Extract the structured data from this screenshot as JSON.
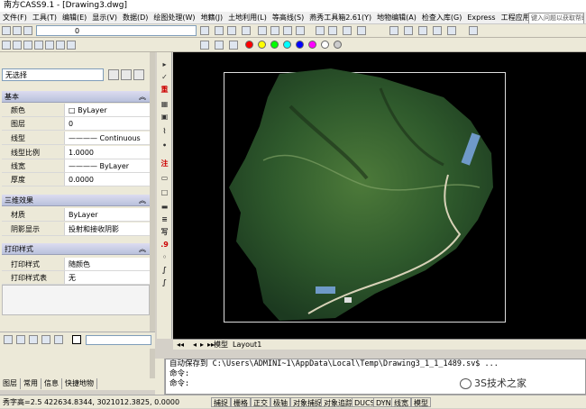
{
  "window": {
    "title": "南方CASS9.1 - [Drawing3.dwg]"
  },
  "menu": [
    "文件(F)",
    "工具(T)",
    "编辑(E)",
    "显示(V)",
    "数据(D)",
    "绘图处理(W)",
    "地籍(J)",
    "土地利用(L)",
    "等高线(S)",
    "燕秀工具箱2.61(Y)",
    "地物编辑(A)",
    "检查入库(G)",
    "Express",
    "工程应用(C)"
  ],
  "help_search": {
    "placeholder": "键入问题以获取帮助"
  },
  "toolbar1": {
    "layer_value": "0"
  },
  "colors": [
    "#ff0000",
    "#ffff00",
    "#00ff00",
    "#00ffff",
    "#0000ff",
    "#ff00ff",
    "#ffffff",
    "#cccccc"
  ],
  "properties": {
    "selection": "无选择",
    "sections": [
      {
        "title": "基本",
        "rows": [
          {
            "key": "颜色",
            "value": "□ ByLayer"
          },
          {
            "key": "图层",
            "value": "0"
          },
          {
            "key": "线型",
            "value": "———— Continuous"
          },
          {
            "key": "线型比例",
            "value": "1.0000"
          },
          {
            "key": "线宽",
            "value": "———— ByLayer"
          },
          {
            "key": "厚度",
            "value": "0.0000"
          }
        ]
      },
      {
        "title": "三维效果",
        "rows": [
          {
            "key": "材质",
            "value": "ByLayer"
          },
          {
            "key": "阴影显示",
            "value": "投射和接收阴影"
          }
        ]
      },
      {
        "title": "打印样式",
        "rows": [
          {
            "key": "打印样式",
            "value": "随颜色"
          },
          {
            "key": "打印样式表",
            "value": "无"
          }
        ]
      }
    ]
  },
  "left_tabs": [
    "图层",
    "常用",
    "信息",
    "快捷地物"
  ],
  "vertical_tools": [
    "重",
    "注",
    "写",
    ".9"
  ],
  "layout_tabs": [
    "模型",
    "Layout1"
  ],
  "command": {
    "line1": "自动保存到 C:\\Users\\ADMINI~1\\AppData\\Local\\Temp\\Drawing3_1_1_1489.sv$ ...",
    "line2": "命令:",
    "line3": "命令:"
  },
  "status": {
    "coords": "秀字高=2.5  422634.8344, 3021012.3825, 0.0000",
    "buttons": [
      "捕捉",
      "栅格",
      "正交",
      "极轴",
      "对象捕捉",
      "对象追踪",
      "DUCS",
      "DYN",
      "线宽",
      "模型"
    ]
  },
  "watermark": "3S技术之家"
}
